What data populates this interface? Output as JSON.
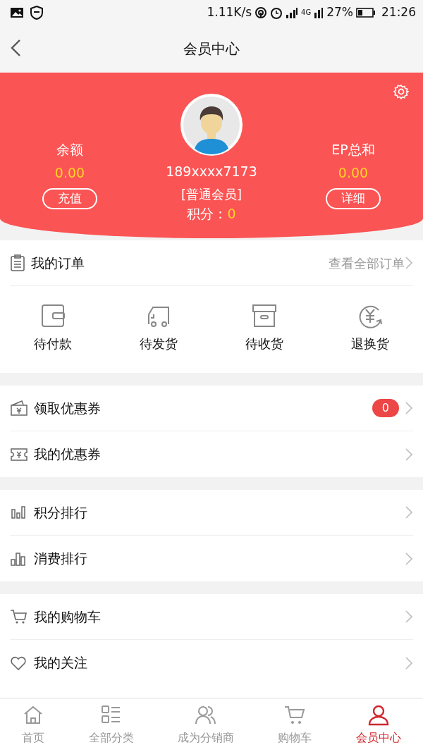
{
  "status_bar": {
    "network_speed": "1.11K/s",
    "network_type": "4G",
    "battery": "27%",
    "time": "21:26"
  },
  "header": {
    "title": "会员中心"
  },
  "profile": {
    "balance_label": "余额",
    "balance_value": "0.00",
    "recharge_button": "充值",
    "phone": "189xxxx7173",
    "member_level": "[普通会员]",
    "points_label": "积分：",
    "points_value": "0",
    "ep_label": "EP总和",
    "ep_value": "0.00",
    "detail_button": "详细"
  },
  "orders": {
    "title": "我的订单",
    "view_all": "查看全部订单",
    "items": [
      {
        "label": "待付款"
      },
      {
        "label": "待发货"
      },
      {
        "label": "待收货"
      },
      {
        "label": "退换货"
      }
    ]
  },
  "menu_groups": [
    {
      "items": [
        {
          "label": "领取优惠券",
          "badge": "0"
        },
        {
          "label": "我的优惠券"
        }
      ]
    },
    {
      "items": [
        {
          "label": "积分排行"
        },
        {
          "label": "消费排行"
        }
      ]
    },
    {
      "items": [
        {
          "label": "我的购物车"
        },
        {
          "label": "我的关注"
        }
      ]
    }
  ],
  "tab_bar": [
    {
      "label": "首页",
      "selected": false
    },
    {
      "label": "全部分类",
      "selected": false
    },
    {
      "label": "成为分销商",
      "selected": false
    },
    {
      "label": "购物车",
      "selected": false
    },
    {
      "label": "会员中心",
      "selected": true
    }
  ]
}
